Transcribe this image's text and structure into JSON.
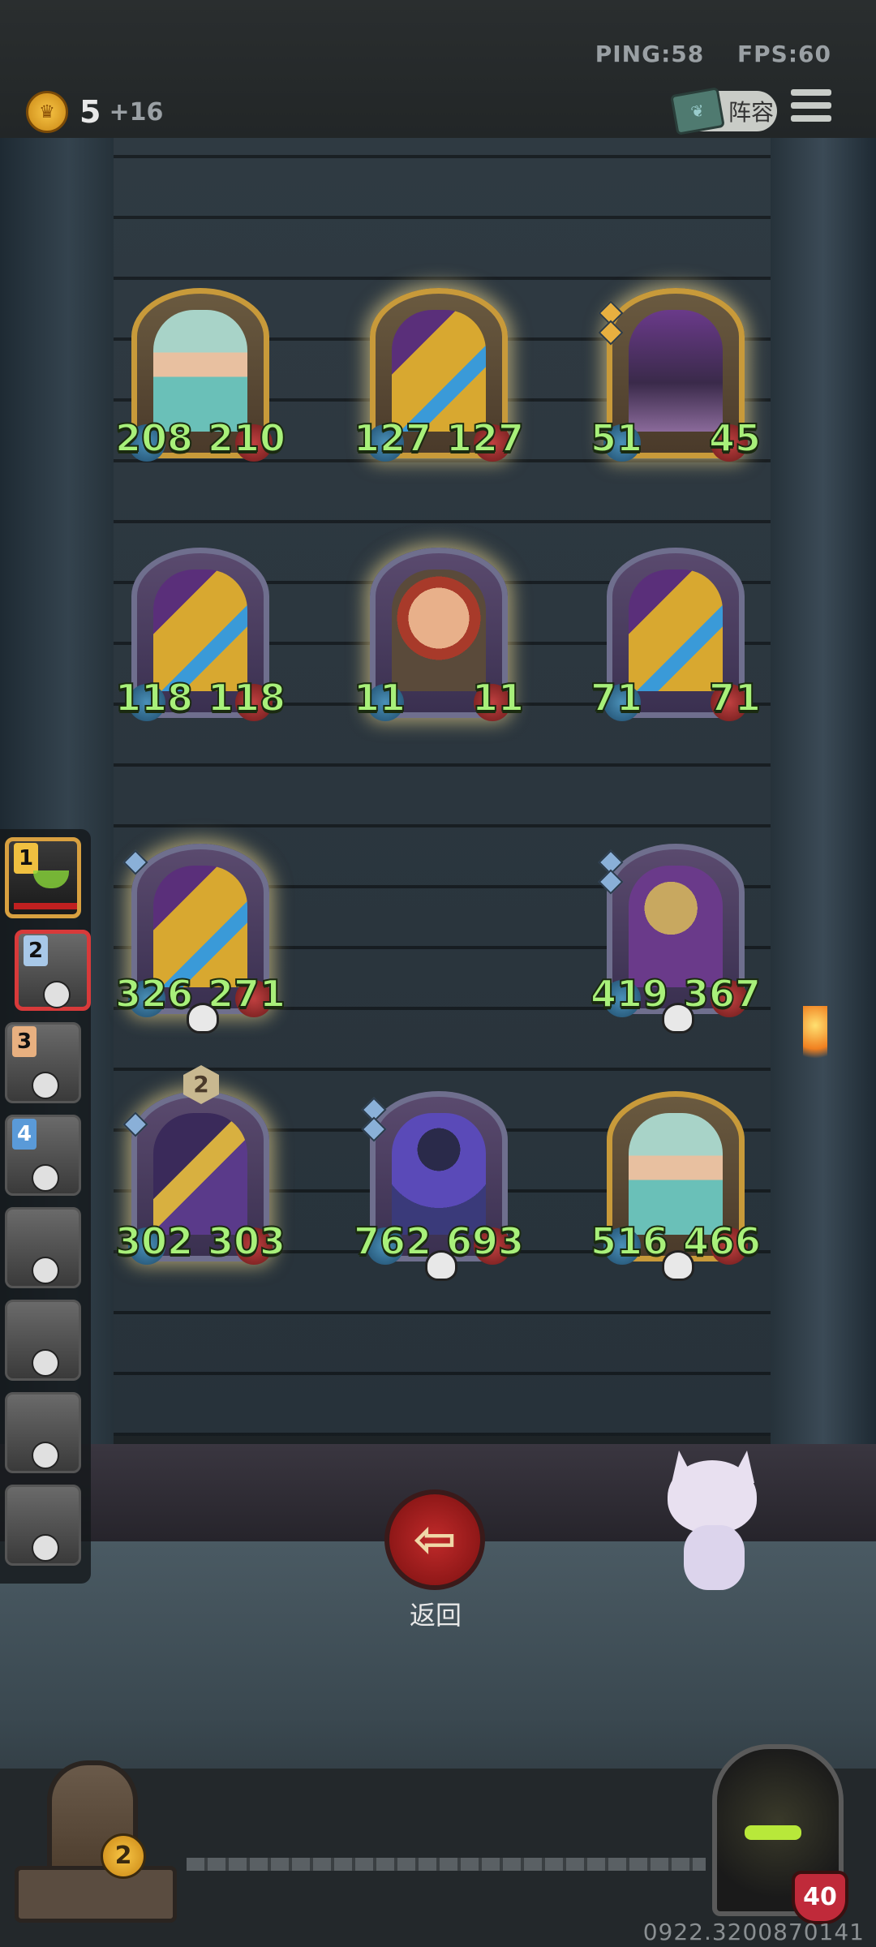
{
  "topbar": {
    "ping": "PING:58",
    "fps": "FPS:60",
    "coins": "5",
    "coin_income": "+16",
    "lineup_label": "阵容"
  },
  "board": {
    "cards": [
      {
        "name": "officer",
        "atk": "208",
        "hp": "210"
      },
      {
        "name": "robot",
        "atk": "127",
        "hp": "127"
      },
      {
        "name": "witch",
        "atk": "51",
        "hp": "45"
      },
      {
        "name": "robot",
        "atk": "118",
        "hp": "118"
      },
      {
        "name": "clown",
        "atk": "11",
        "hp": "11"
      },
      {
        "name": "robot",
        "atk": "71",
        "hp": "71"
      },
      {
        "name": "robot",
        "atk": "326",
        "hp": "271"
      },
      {
        "name": "egg-robot",
        "atk": "419",
        "hp": "367"
      },
      {
        "name": "wizard",
        "atk": "302",
        "hp": "303",
        "tier": "2"
      },
      {
        "name": "mech",
        "atk": "762",
        "hp": "693"
      },
      {
        "name": "officer",
        "atk": "516",
        "hp": "466"
      }
    ]
  },
  "sidebar": {
    "ranks": [
      "1",
      "2",
      "3",
      "4"
    ]
  },
  "return_label": "返回",
  "chest_count": "2",
  "hero_health": "40",
  "version": "0922.3200870141"
}
